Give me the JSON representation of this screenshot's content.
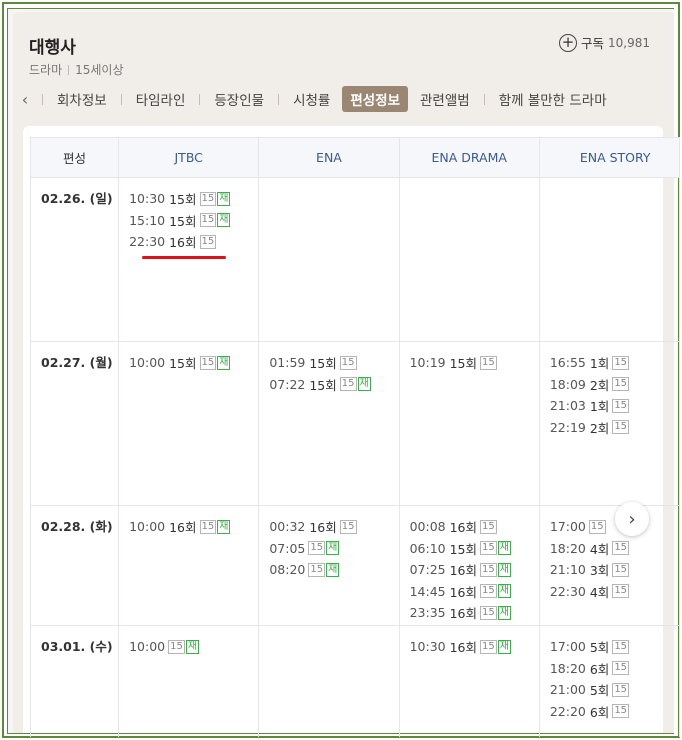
{
  "header": {
    "title": "대행사",
    "genre": "드라마",
    "rating": "15세이상",
    "subscribe_label": "구독",
    "subscribe_count": "10,981"
  },
  "tabs": [
    {
      "label": "회차정보",
      "active": false
    },
    {
      "label": "타임라인",
      "active": false
    },
    {
      "label": "등장인물",
      "active": false
    },
    {
      "label": "시청률",
      "active": false
    },
    {
      "label": "편성정보",
      "active": true
    },
    {
      "label": "관련앨범",
      "active": false
    },
    {
      "label": "함께 볼만한 드라마",
      "active": false
    }
  ],
  "schedule": {
    "corner_header": "편성",
    "channels": [
      "JTBC",
      "ENA",
      "ENA DRAMA",
      "ENA STORY"
    ],
    "rows": [
      {
        "date": "02.26. (일)",
        "cells": [
          [
            {
              "time": "10:30",
              "ep": "15회",
              "rating": "15",
              "rerun": "재"
            },
            {
              "time": "15:10",
              "ep": "15회",
              "rating": "15",
              "rerun": "재"
            },
            {
              "time": "22:30",
              "ep": "16회",
              "rating": "15",
              "rerun": ""
            }
          ],
          [],
          [],
          []
        ]
      },
      {
        "date": "02.27. (월)",
        "cells": [
          [
            {
              "time": "10:00",
              "ep": "15회",
              "rating": "15",
              "rerun": "재"
            }
          ],
          [
            {
              "time": "01:59",
              "ep": "15회",
              "rating": "15",
              "rerun": ""
            },
            {
              "time": "07:22",
              "ep": "15회",
              "rating": "15",
              "rerun": "재"
            }
          ],
          [
            {
              "time": "10:19",
              "ep": "15회",
              "rating": "15",
              "rerun": ""
            }
          ],
          [
            {
              "time": "16:55",
              "ep": "1회",
              "rating": "15",
              "rerun": ""
            },
            {
              "time": "18:09",
              "ep": "2회",
              "rating": "15",
              "rerun": ""
            },
            {
              "time": "21:03",
              "ep": "1회",
              "rating": "15",
              "rerun": ""
            },
            {
              "time": "22:19",
              "ep": "2회",
              "rating": "15",
              "rerun": ""
            }
          ]
        ]
      },
      {
        "date": "02.28. (화)",
        "cells": [
          [
            {
              "time": "10:00",
              "ep": "16회",
              "rating": "15",
              "rerun": "재"
            }
          ],
          [
            {
              "time": "00:32",
              "ep": "16회",
              "rating": "15",
              "rerun": ""
            },
            {
              "time": "07:05",
              "ep": "",
              "rating": "15",
              "rerun": "재"
            },
            {
              "time": "08:20",
              "ep": "",
              "rating": "15",
              "rerun": "재"
            }
          ],
          [
            {
              "time": "00:08",
              "ep": "16회",
              "rating": "15",
              "rerun": ""
            },
            {
              "time": "06:10",
              "ep": "15회",
              "rating": "15",
              "rerun": "재"
            },
            {
              "time": "07:25",
              "ep": "16회",
              "rating": "15",
              "rerun": "재"
            },
            {
              "time": "14:45",
              "ep": "16회",
              "rating": "15",
              "rerun": "재"
            },
            {
              "time": "23:35",
              "ep": "16회",
              "rating": "15",
              "rerun": "재"
            }
          ],
          [
            {
              "time": "17:00",
              "ep": "",
              "rating": "15",
              "rerun": ""
            },
            {
              "time": "18:20",
              "ep": "4회",
              "rating": "15",
              "rerun": ""
            },
            {
              "time": "21:10",
              "ep": "3회",
              "rating": "15",
              "rerun": ""
            },
            {
              "time": "22:30",
              "ep": "4회",
              "rating": "15",
              "rerun": ""
            }
          ]
        ]
      },
      {
        "date": "03.01. (수)",
        "cells": [
          [
            {
              "time": "10:00",
              "ep": "",
              "rating": "15",
              "rerun": "재"
            }
          ],
          [],
          [
            {
              "time": "10:30",
              "ep": "16회",
              "rating": "15",
              "rerun": "재"
            }
          ],
          [
            {
              "time": "17:00",
              "ep": "5회",
              "rating": "15",
              "rerun": ""
            },
            {
              "time": "18:20",
              "ep": "6회",
              "rating": "15",
              "rerun": ""
            },
            {
              "time": "21:00",
              "ep": "5회",
              "rating": "15",
              "rerun": ""
            },
            {
              "time": "22:20",
              "ep": "6회",
              "rating": "15",
              "rerun": ""
            }
          ]
        ]
      }
    ]
  },
  "icons": {
    "prev_tabs": "chevron-left-icon",
    "subscribe": "plus-circle-icon",
    "next_page": "chevron-right-icon"
  },
  "colors": {
    "active_tab_bg": "#9a8672",
    "rerun_badge": "#3cae4a",
    "channel_header_text": "#3a5b8c",
    "highlight_underline": "#e2101a",
    "frame_border": "#5d8a3a"
  }
}
